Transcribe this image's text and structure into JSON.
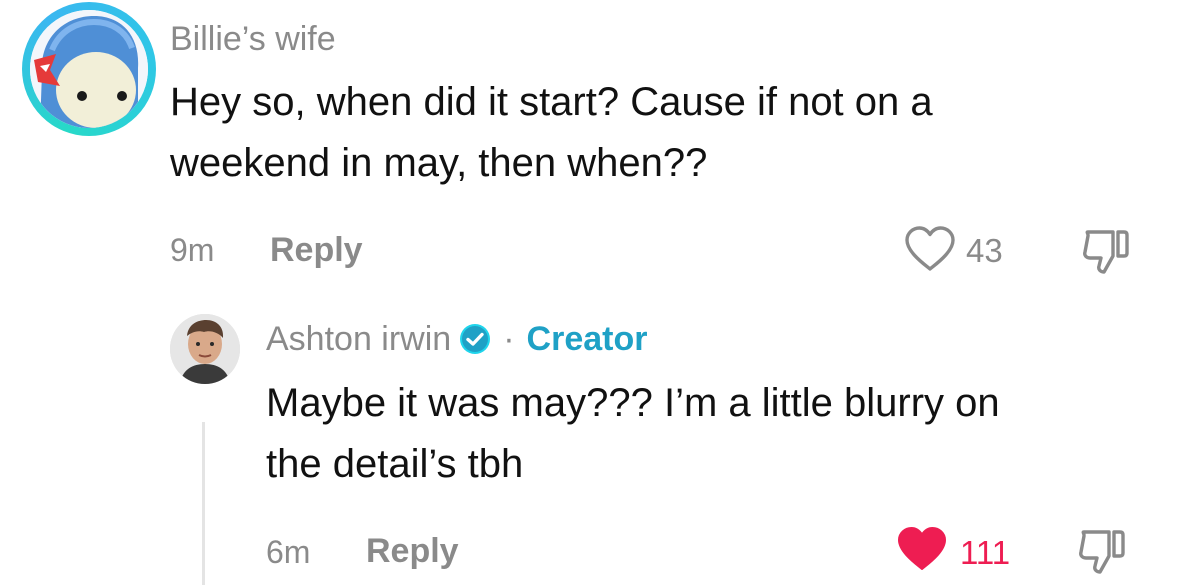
{
  "comments": [
    {
      "username": "Billie’s wife",
      "text_line1": "Hey so, when did it start? Cause if not on a",
      "text_line2": "weekend in may, then when??",
      "time": "9m",
      "reply_label": "Reply",
      "likes": "43",
      "liked": false
    },
    {
      "username": "Ashton irwin",
      "verified": true,
      "separator": "·",
      "badge": "Creator",
      "text_line1": "Maybe it was may??? I’m a little blurry on",
      "text_line2": "the detail’s tbh",
      "time": "6m",
      "reply_label": "Reply",
      "likes": "111",
      "liked": true
    }
  ],
  "icons": {
    "like": "heart-icon",
    "dislike": "thumbs-down-icon",
    "verified": "verified-check-icon"
  },
  "colors": {
    "accent_creator": "#1fa1c6",
    "liked": "#ee1d52",
    "muted": "#8a8a8a",
    "avatar_ring": "#2fc7e6"
  }
}
